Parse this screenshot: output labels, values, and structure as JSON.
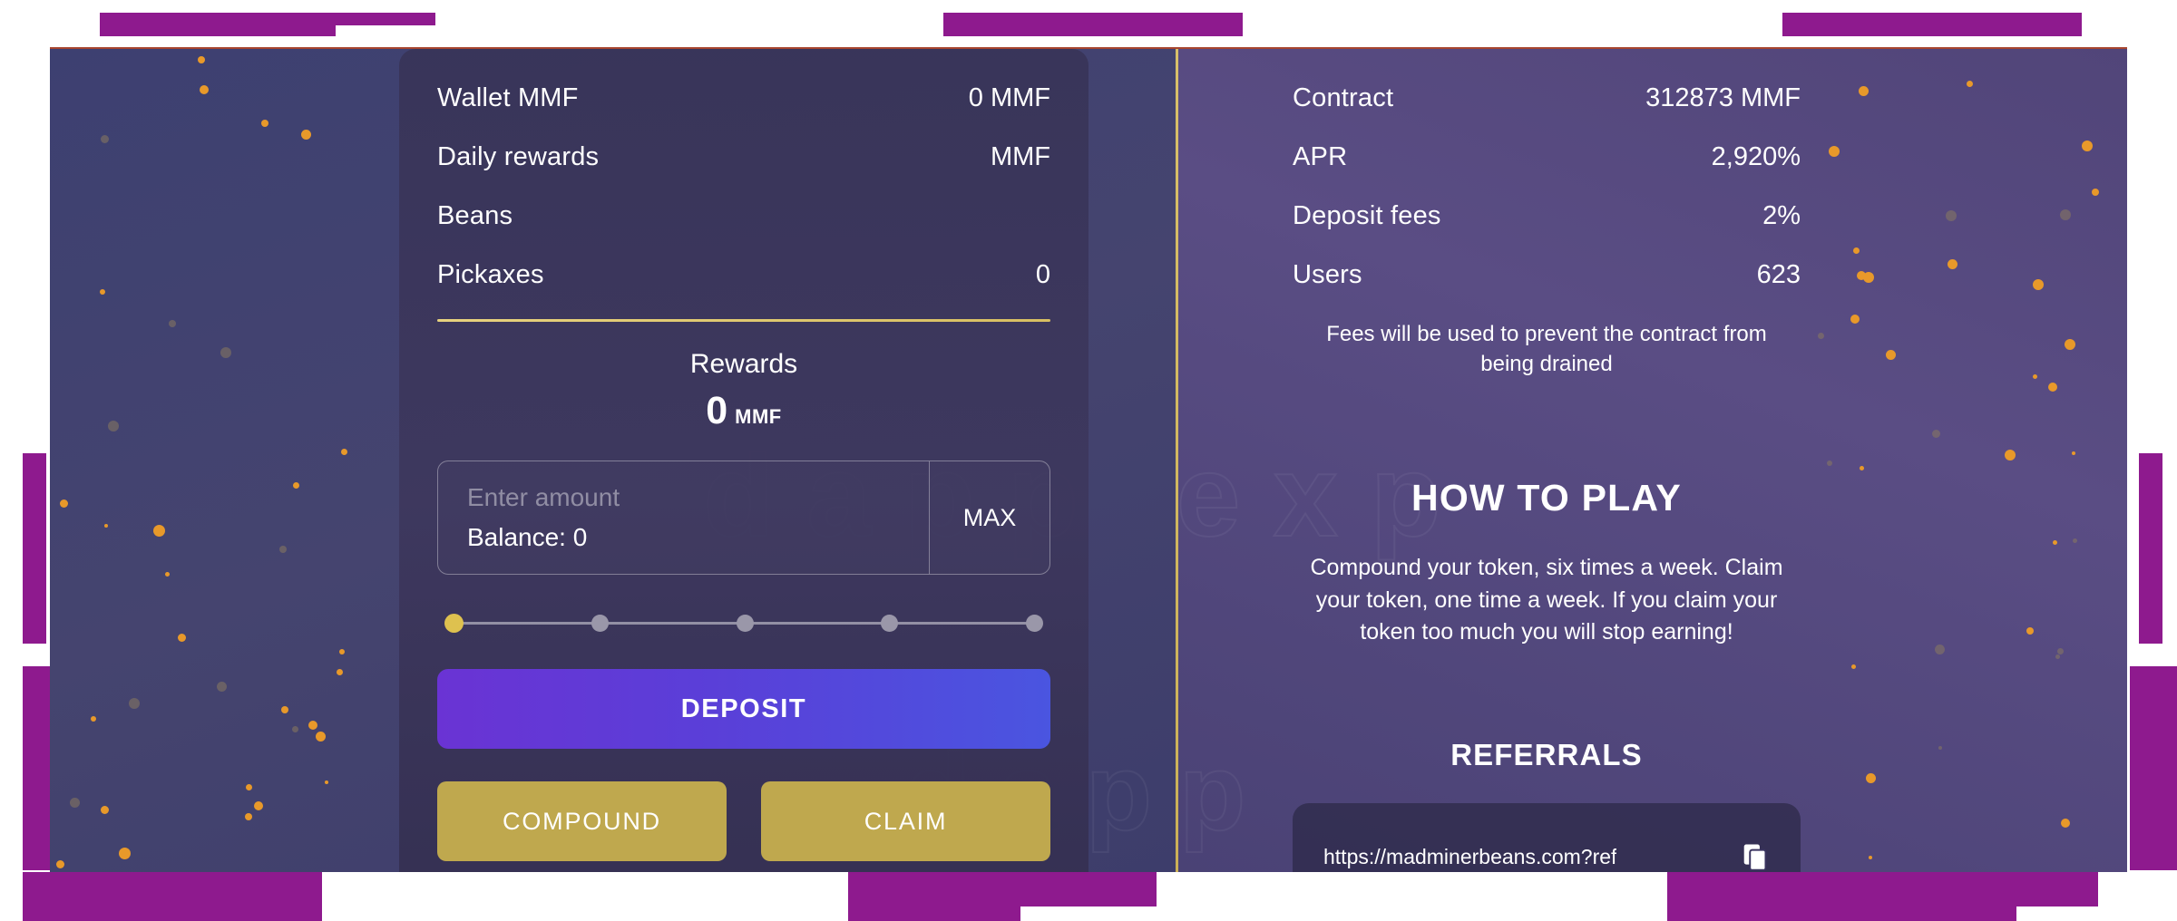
{
  "app": {
    "watermark_line1": "dapp exp",
    "watermark_line2": "dapp"
  },
  "left_panel": {
    "stats": [
      {
        "label": "Wallet MMF",
        "value": "0 MMF"
      },
      {
        "label": "Daily rewards",
        "value": "MMF"
      },
      {
        "label": "Beans",
        "value": ""
      },
      {
        "label": "Pickaxes",
        "value": "0"
      }
    ],
    "rewards": {
      "title": "Rewards",
      "amount": "0",
      "unit": "MMF"
    },
    "input": {
      "placeholder": "Enter amount",
      "value": "",
      "balance_label": "Balance: 0",
      "max_label": "MAX"
    },
    "slider": {
      "steps": 5,
      "active_index": 0
    },
    "buttons": {
      "deposit": "DEPOSIT",
      "compound": "COMPOUND",
      "claim": "CLAIM"
    }
  },
  "right_panel": {
    "stats": [
      {
        "label": "Contract",
        "value": "312873 MMF"
      },
      {
        "label": "APR",
        "value": "2,920%"
      },
      {
        "label": "Deposit fees",
        "value": "2%"
      },
      {
        "label": "Users",
        "value": "623"
      }
    ],
    "fees_note": "Fees will be used to prevent the contract from being drained",
    "how_to_play": {
      "title": "HOW TO PLAY",
      "body": "Compound your token, six times a week. Claim your token, one time a week. If you claim your token too much you will stop earning!"
    },
    "referrals": {
      "title": "REFERRALS",
      "url": "https://madminerbeans.com?ref",
      "copy_icon": "copy-icon"
    }
  },
  "colors": {
    "accent_gold": "#d8bf62",
    "deposit_gradient_start": "#6a33d4",
    "deposit_gradient_end": "#4a55e0",
    "gold_button": "#bfa84e",
    "deco_purple": "#8e1a8e",
    "particle": "#e8992a"
  }
}
